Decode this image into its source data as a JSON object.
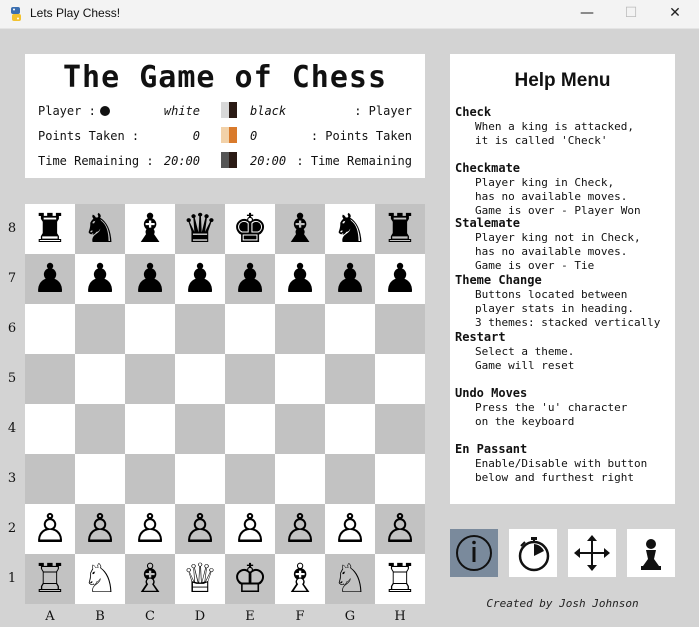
{
  "window": {
    "icon": "python-icon",
    "title": "Lets Play Chess!",
    "minimize": "—",
    "maximize": "☐",
    "close": "✕"
  },
  "header": {
    "title": "The Game of Chess",
    "player_label_left": "Player :",
    "player_white": "white",
    "player_black": "black",
    "player_label_right": ": Player",
    "points_label_left": "Points Taken :",
    "points_white": "0",
    "points_black": "0",
    "points_label_right": ": Points Taken",
    "time_label_left": "Time Remaining :",
    "time_white": "20:00",
    "time_black": "20:00",
    "time_label_right": ": Time Remaining",
    "swatch_colors": {
      "row1": [
        "#d8d8d8",
        "#2a1a14"
      ],
      "row2": [
        "#f2d1a8",
        "#d97a2b"
      ],
      "row3": [
        "#555555",
        "#2a1a14"
      ]
    }
  },
  "board": {
    "colors": {
      "light": "#ffffff",
      "dark": "#c2c2c2"
    },
    "ranks": [
      "8",
      "7",
      "6",
      "5",
      "4",
      "3",
      "2",
      "1"
    ],
    "files": [
      "A",
      "B",
      "C",
      "D",
      "E",
      "F",
      "G",
      "H"
    ],
    "rows": [
      [
        "♜",
        "♞",
        "♝",
        "♛",
        "♚",
        "♝",
        "♞",
        "♜"
      ],
      [
        "♟",
        "♟",
        "♟",
        "♟",
        "♟",
        "♟",
        "♟",
        "♟"
      ],
      [
        "",
        "",
        "",
        "",
        "",
        "",
        "",
        ""
      ],
      [
        "",
        "",
        "",
        "",
        "",
        "",
        "",
        ""
      ],
      [
        "",
        "",
        "",
        "",
        "",
        "",
        "",
        ""
      ],
      [
        "",
        "",
        "",
        "",
        "",
        "",
        "",
        ""
      ],
      [
        "♙",
        "♙",
        "♙",
        "♙",
        "♙",
        "♙",
        "♙",
        "♙"
      ],
      [
        "♖",
        "♘",
        "♗",
        "♕",
        "♔",
        "♗",
        "♘",
        "♖"
      ]
    ]
  },
  "help": {
    "title": "Help Menu",
    "sections": [
      {
        "heading": "Check",
        "lines": [
          "When a king is attacked,",
          "it is called 'Check'"
        ]
      },
      {
        "heading": "Checkmate",
        "lines": [
          "Player king in Check,",
          "has no available moves.",
          "Game is over - Player Won"
        ]
      },
      {
        "heading": "Stalemate",
        "lines": [
          "Player king not in Check,",
          "has no available moves.",
          "Game is over - Tie"
        ]
      },
      {
        "heading": "Theme Change",
        "lines": [
          "Buttons located between",
          "player stats in heading.",
          "3 themes: stacked vertically"
        ]
      },
      {
        "heading": "Restart",
        "lines": [
          "Select a theme.",
          "Game will reset"
        ]
      },
      {
        "heading": "Undo Moves",
        "lines": [
          "Press the 'u' character",
          "on the keyboard"
        ]
      },
      {
        "heading": "En Passant",
        "lines": [
          "Enable/Disable with button",
          "below and furthest right"
        ]
      }
    ]
  },
  "buttons": [
    {
      "name": "info-button",
      "icon": "info-icon",
      "active": true
    },
    {
      "name": "timer-button",
      "icon": "stopwatch-icon",
      "active": false
    },
    {
      "name": "move-button",
      "icon": "move-arrows-icon",
      "active": false
    },
    {
      "name": "en-passant-button",
      "icon": "pawn-icon",
      "active": false
    }
  ],
  "credit": "Created by Josh Johnson"
}
